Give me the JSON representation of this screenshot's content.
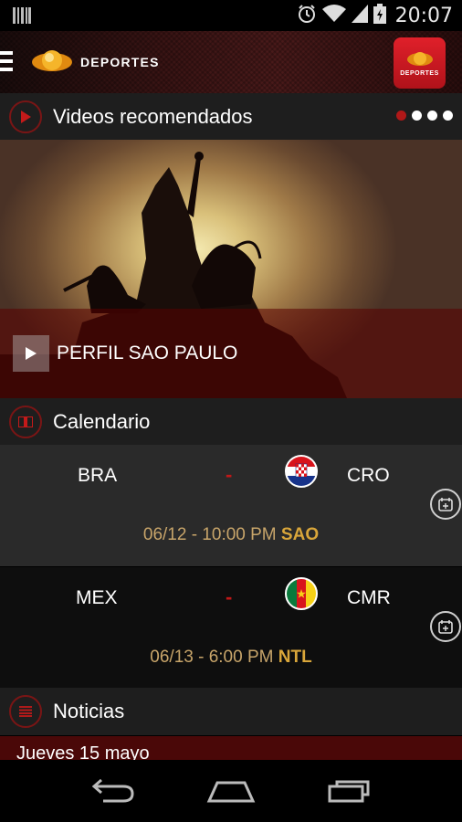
{
  "status_bar": {
    "time": "20:07",
    "icons": [
      "barcode-icon",
      "alarm-icon",
      "wifi-icon",
      "signal-icon",
      "battery-charging-icon"
    ]
  },
  "app_bar": {
    "brand": "DEPORTES",
    "badge_label": "DEPORTES",
    "brand_color": "#f2a020",
    "accent_color": "#c41a1a"
  },
  "videos": {
    "header": "Videos recomendados",
    "carousel_total": 4,
    "carousel_active": 1,
    "current_title": "PERFIL SAO PAULO"
  },
  "calendar": {
    "header": "Calendario",
    "matches": [
      {
        "home": "BRA",
        "separator": "-",
        "away": "CRO",
        "away_flag": "croatia-flag",
        "date": "06/12 - 10:00 PM",
        "venue": "SAO"
      },
      {
        "home": "MEX",
        "separator": "-",
        "away": "CMR",
        "away_flag": "cameroon-flag",
        "date": "06/13 - 6:00 PM",
        "venue": "NTL"
      }
    ]
  },
  "news": {
    "header": "Noticias",
    "preview_heading": "Jueves 15 mayo"
  }
}
